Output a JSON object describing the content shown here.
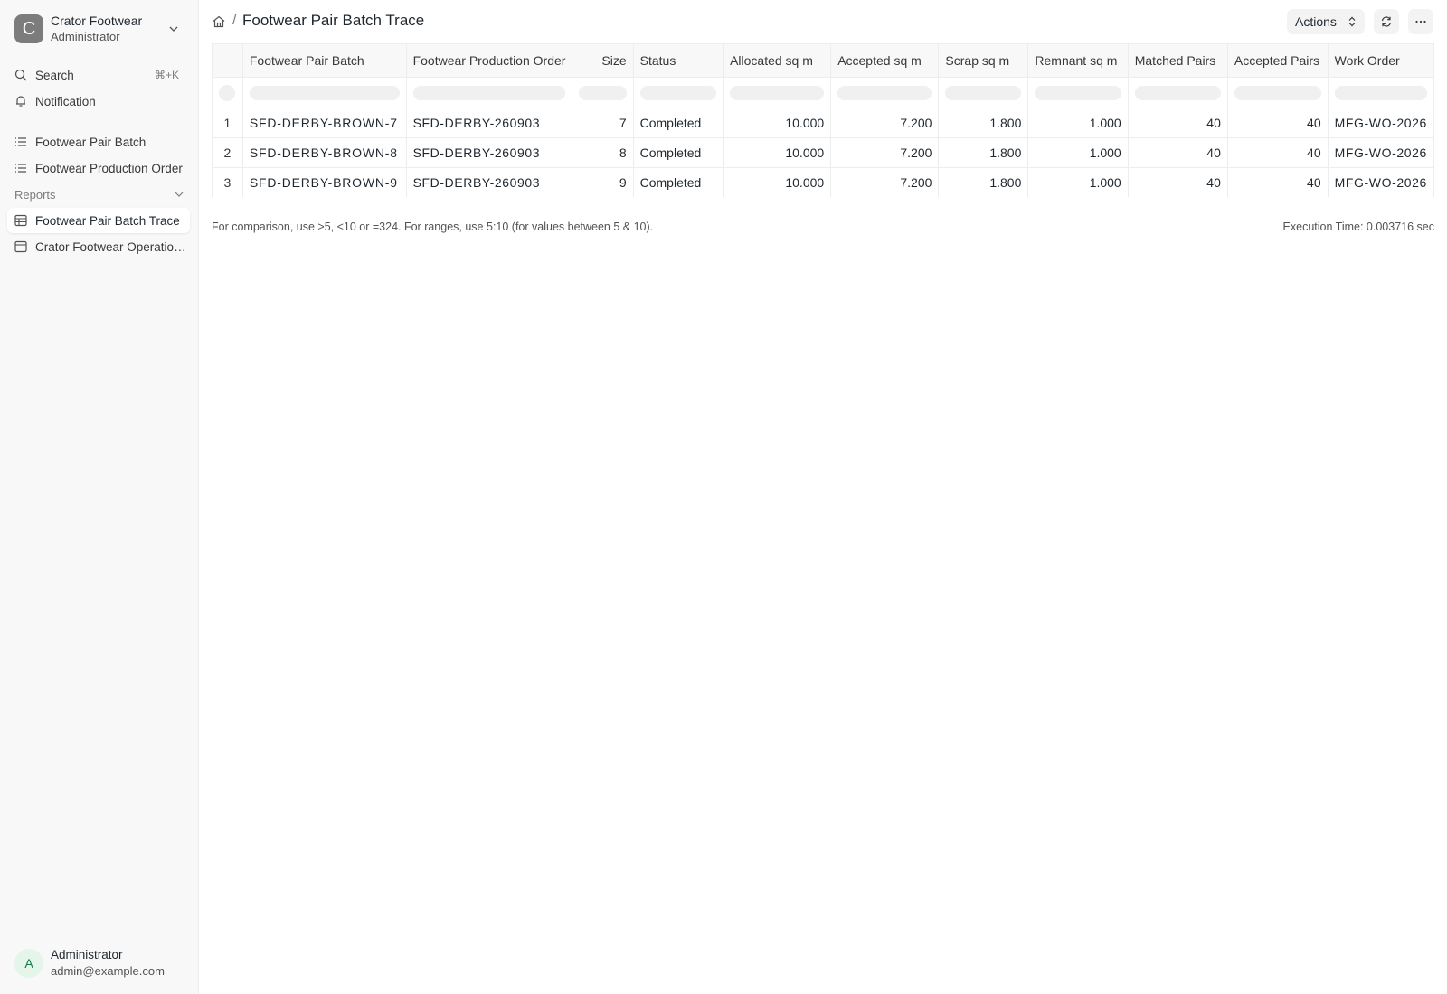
{
  "workspace": {
    "name": "Crator Footwear",
    "role": "Administrator",
    "logo_letter": "C"
  },
  "nav": {
    "search_label": "Search",
    "search_shortcut": "⌘+K",
    "notification_label": "Notification",
    "items": [
      "Footwear Pair Batch",
      "Footwear Production Order"
    ],
    "reports_label": "Reports",
    "reports": [
      "Footwear Pair Batch Trace",
      "Crator Footwear Operations Summary"
    ]
  },
  "user": {
    "name": "Administrator",
    "email": "admin@example.com",
    "initial": "A"
  },
  "header": {
    "separator": "/",
    "title": "Footwear Pair Batch Trace",
    "actions_label": "Actions"
  },
  "table": {
    "columns": [
      "Footwear Pair Batch",
      "Footwear Production Order",
      "Size",
      "Status",
      "Allocated sq m",
      "Accepted sq m",
      "Scrap sq m",
      "Remnant sq m",
      "Matched Pairs",
      "Accepted Pairs",
      "Work Order"
    ],
    "rows": [
      {
        "num": "1",
        "cells": [
          "SFD-DERBY-BROWN-7",
          "SFD-DERBY-260903",
          "7",
          "Completed",
          "10.000",
          "7.200",
          "1.800",
          "1.000",
          "40",
          "40",
          "MFG-WO-2026"
        ]
      },
      {
        "num": "2",
        "cells": [
          "SFD-DERBY-BROWN-8",
          "SFD-DERBY-260903",
          "8",
          "Completed",
          "10.000",
          "7.200",
          "1.800",
          "1.000",
          "40",
          "40",
          "MFG-WO-2026"
        ]
      },
      {
        "num": "3",
        "cells": [
          "SFD-DERBY-BROWN-9",
          "SFD-DERBY-260903",
          "9",
          "Completed",
          "10.000",
          "7.200",
          "1.800",
          "1.000",
          "40",
          "40",
          "MFG-WO-2026"
        ]
      }
    ]
  },
  "footer": {
    "hint": "For comparison, use >5, <10 or =324. For ranges, use 5:10 (for values between 5 & 10).",
    "execution": "Execution Time: 0.003716 sec"
  }
}
